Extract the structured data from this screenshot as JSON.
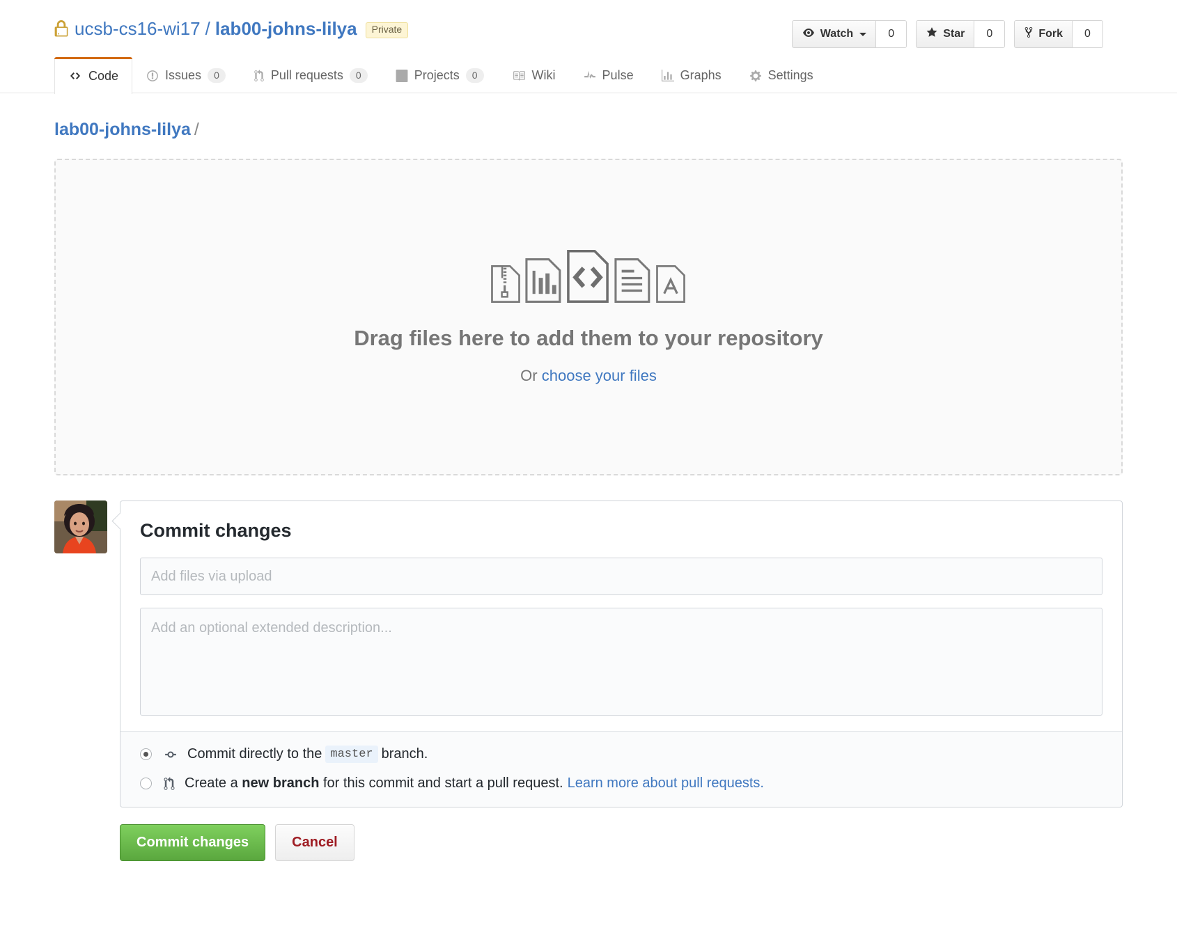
{
  "repo": {
    "owner": "ucsb-cs16-wi17",
    "separator": "/",
    "name": "lab00-johns-lilya",
    "visibility": "Private",
    "lock_icon": "lock-icon"
  },
  "actions": [
    {
      "label": "Watch",
      "count": "0",
      "icon": "eye-icon",
      "has_caret": true
    },
    {
      "label": "Star",
      "count": "0",
      "icon": "star-icon",
      "has_caret": false
    },
    {
      "label": "Fork",
      "count": "0",
      "icon": "repo-forked-icon",
      "has_caret": false
    }
  ],
  "nav": [
    {
      "label": "Code",
      "icon": "code-icon",
      "count": null,
      "selected": true
    },
    {
      "label": "Issues",
      "icon": "issue-opened-icon",
      "count": "0",
      "selected": false
    },
    {
      "label": "Pull requests",
      "icon": "git-pull-request-icon",
      "count": "0",
      "selected": false
    },
    {
      "label": "Projects",
      "icon": "project-icon",
      "count": "0",
      "selected": false
    },
    {
      "label": "Wiki",
      "icon": "book-icon",
      "count": null,
      "selected": false
    },
    {
      "label": "Pulse",
      "icon": "pulse-icon",
      "count": null,
      "selected": false
    },
    {
      "label": "Graphs",
      "icon": "graph-icon",
      "count": null,
      "selected": false
    },
    {
      "label": "Settings",
      "icon": "gear-icon",
      "count": null,
      "selected": false
    }
  ],
  "breadcrumb": {
    "repo_link": "lab00-johns-lilya",
    "slash": "/"
  },
  "dropzone": {
    "title": "Drag files here to add them to your repository",
    "or_text": "Or",
    "choose_link": "choose your files",
    "icons": [
      "file-zip-icon",
      "file-chart-icon",
      "file-code-icon",
      "file-text-icon",
      "file-pdf-icon"
    ]
  },
  "commit": {
    "heading": "Commit changes",
    "message_placeholder": "Add files via upload",
    "message_value": "",
    "description_placeholder": "Add an optional extended description...",
    "description_value": "",
    "options": [
      {
        "selected": true,
        "icon": "git-commit-icon",
        "text_before": "Commit directly to the",
        "branch": "master",
        "text_after": "branch."
      },
      {
        "selected": false,
        "icon": "git-pull-request-icon",
        "text_before": "Create a",
        "emphasis": "new branch",
        "text_after": "for this commit and start a pull request.",
        "link": "Learn more about pull requests."
      }
    ],
    "submit_label": "Commit changes",
    "cancel_label": "Cancel"
  },
  "colors": {
    "link": "#4078c0",
    "active_tab_border": "#d26911",
    "private_badge_bg": "#fdf5d5",
    "commit_button": "#5aa73e",
    "cancel_text": "#9e1c23"
  }
}
